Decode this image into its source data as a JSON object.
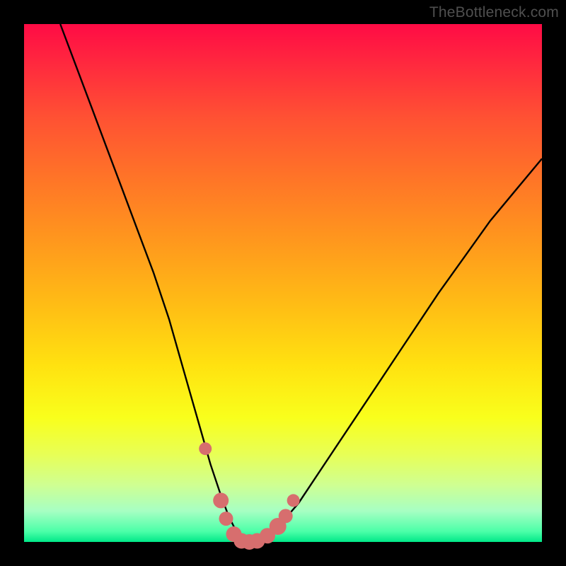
{
  "watermark": "TheBottleneck.com",
  "colors": {
    "frame": "#000000",
    "curve": "#000000",
    "marker": "#d76e6e",
    "gradient_top": "#ff0b45",
    "gradient_bottom": "#00e888"
  },
  "chart_data": {
    "type": "line",
    "title": "",
    "xlabel": "",
    "ylabel": "",
    "xlim": [
      0,
      100
    ],
    "ylim": [
      0,
      100
    ],
    "series": [
      {
        "name": "bottleneck-curve",
        "x": [
          7,
          10,
          13,
          16,
          19,
          22,
          25,
          28,
          30,
          32,
          34,
          36,
          38,
          39.5,
          41,
          42.5,
          44,
          46,
          48,
          50,
          53,
          56,
          60,
          64,
          68,
          72,
          76,
          80,
          85,
          90,
          95,
          100
        ],
        "y": [
          100,
          92,
          84,
          76,
          68,
          60,
          52,
          43,
          36,
          29,
          22,
          15,
          9,
          5,
          2,
          0.5,
          0,
          0.5,
          2,
          4,
          7.5,
          12,
          18,
          24,
          30,
          36,
          42,
          48,
          55,
          62,
          68,
          74
        ]
      }
    ],
    "markers": {
      "name": "highlight-dots",
      "x": [
        35,
        38,
        39,
        40.5,
        42,
        43.5,
        45,
        47,
        49,
        50.5,
        52
      ],
      "y": [
        18,
        8,
        4.5,
        1.5,
        0.2,
        0,
        0.2,
        1.2,
        3,
        5,
        8
      ],
      "r": [
        9,
        11,
        10,
        11,
        11,
        11,
        11,
        11,
        12,
        10,
        9
      ]
    }
  }
}
